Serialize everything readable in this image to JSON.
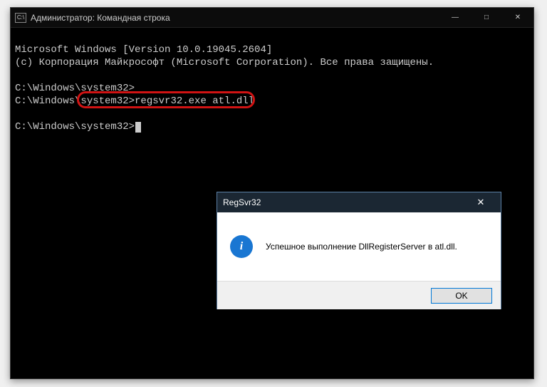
{
  "console": {
    "title": "Администратор: Командная строка",
    "lines": {
      "l1": "Microsoft Windows [Version 10.0.19045.2604]",
      "l2": "(c) Корпорация Майкрософт (Microsoft Corporation). Все права защищены.",
      "blank1": "",
      "p1": "C:\\Windows\\system32>",
      "p2_prompt": "C:\\Windows\\system32>",
      "p2_cmd": "regsvr32.exe atl.dll",
      "blank2": "",
      "p3": "C:\\Windows\\system32>"
    }
  },
  "dialog": {
    "title": "RegSvr32",
    "message": "Успешное выполнение DllRegisterServer в atl.dll.",
    "ok_label": "OK",
    "icon_label": "i"
  },
  "winbtns": {
    "min": "—",
    "max": "□",
    "close": "✕"
  }
}
